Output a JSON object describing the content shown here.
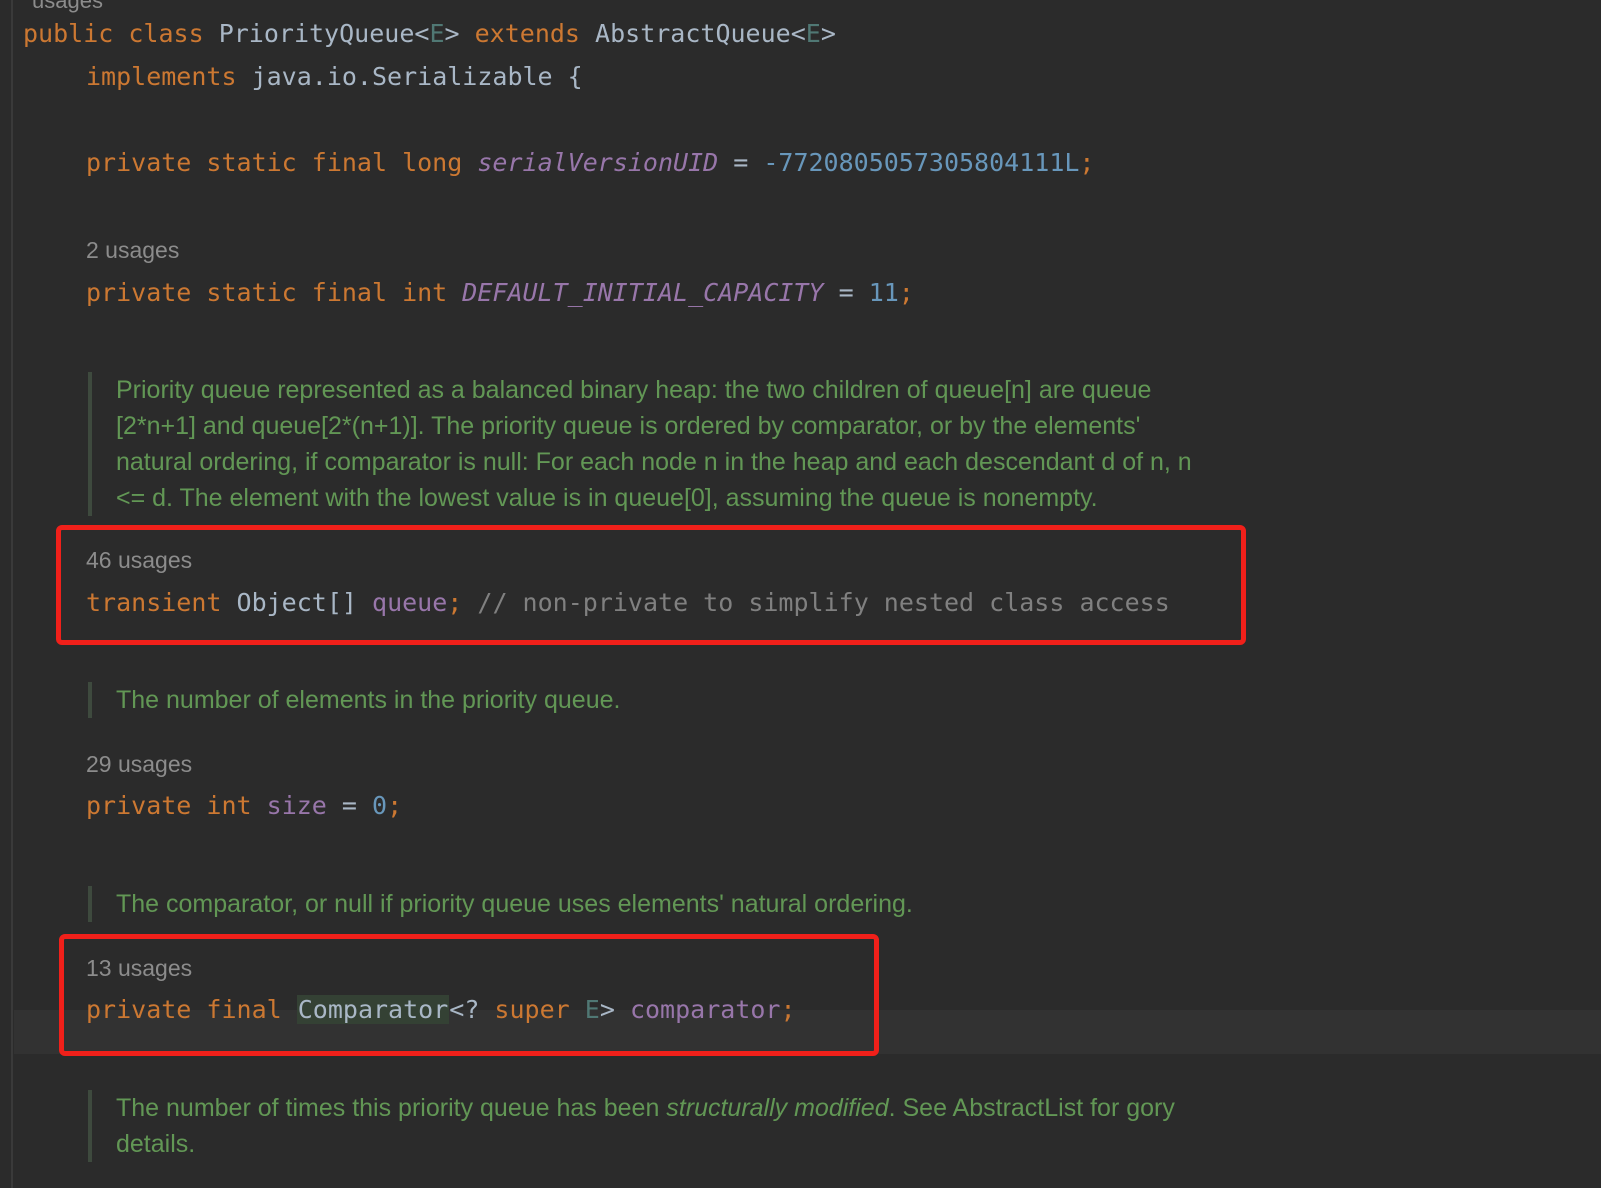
{
  "top_stub": "usages",
  "class_decl": {
    "kw_public": "public",
    "kw_class": "class",
    "class_name": "PriorityQueue",
    "lt1": "<",
    "tparam1": "E",
    "gt1": ">",
    "kw_extends": "extends",
    "super_name": "AbstractQueue",
    "lt2": "<",
    "tparam2": "E",
    "gt2": ">"
  },
  "implements_line": {
    "kw_implements": "implements",
    "iface": "java.io.Serializable",
    "brace": "{"
  },
  "serial_line": {
    "mods": "private static final long",
    "name": "serialVersionUID",
    "eq": " = ",
    "value": "-7720805057305804111L",
    "semi": ";"
  },
  "default_capacity": {
    "usages": "2 usages",
    "mods": "private static final int",
    "name": "DEFAULT_INITIAL_CAPACITY",
    "eq": " = ",
    "value": "11",
    "semi": ";"
  },
  "doc_queue": {
    "lines": [
      "Priority queue represented as a balanced binary heap: the two children of queue[n] are queue",
      "[2*n+1] and queue[2*(n+1)]. The priority queue is ordered by comparator, or by the elements'",
      "natural ordering, if comparator is null: For each node n in the heap and each descendant d of n, n",
      "<= d. The element with the lowest value is in queue[0], assuming the queue is nonempty."
    ]
  },
  "queue_field": {
    "usages": "46 usages",
    "kw": "transient",
    "type": "Object[]",
    "name": "queue",
    "semi": ";",
    "comment": "// non-private to simplify nested class access"
  },
  "doc_size": {
    "text": "The number of elements in the priority queue."
  },
  "size_field": {
    "usages": "29 usages",
    "kw1": "private",
    "kw2": "int",
    "name": "size",
    "eq": " = ",
    "value": "0",
    "semi": ";"
  },
  "doc_comparator": {
    "text": "The comparator, or null if priority queue uses elements' natural ordering."
  },
  "comparator_field": {
    "usages": "13 usages",
    "kw1": "private",
    "kw2": "final",
    "type": "Comparator",
    "wild": "<? ",
    "kw_super": "super",
    "tparam": "E",
    "gt": ">",
    "name": "comparator",
    "semi": ";"
  },
  "doc_modcount": {
    "line1_a": "The number of times this priority queue has been ",
    "line1_em": "structurally modified",
    "line1_b": ". See AbstractList for gory",
    "line2": "details."
  },
  "colors": {
    "background": "#2b2b2b",
    "keyword": "#cc7832",
    "field": "#9876aa",
    "number": "#6897bb",
    "doc_comment": "#629755",
    "line_comment": "#808080",
    "highlight_box": "#f0201a"
  }
}
